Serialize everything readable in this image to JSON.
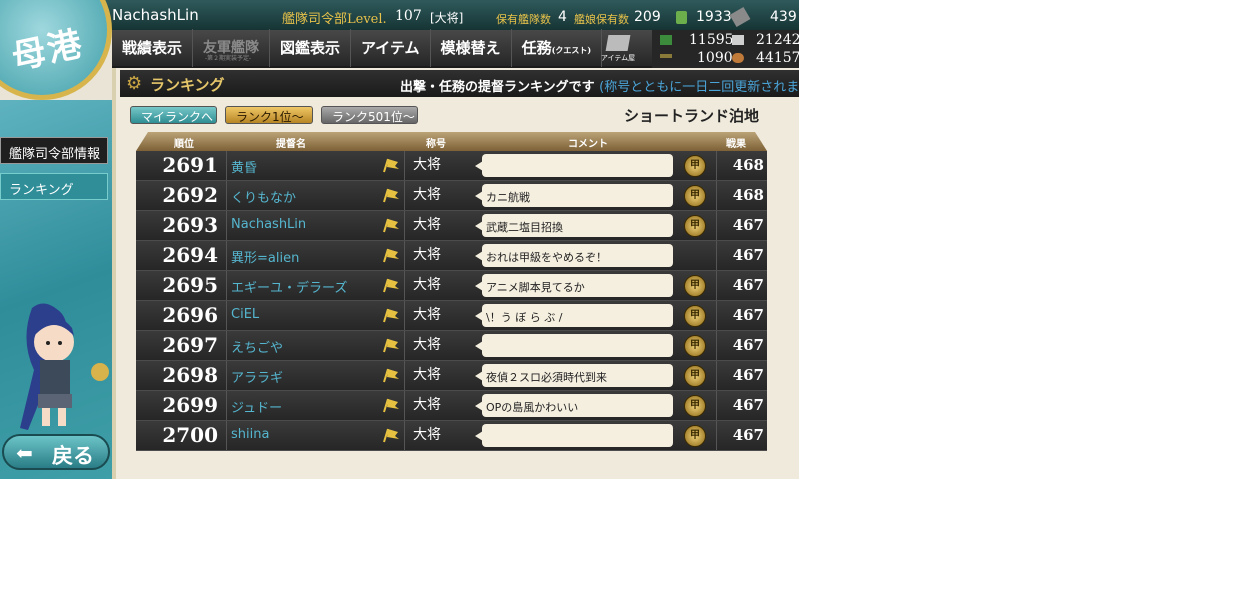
{
  "header": {
    "player_name": "NachashLin",
    "hq_level_label": "艦隊司令部Level.",
    "hq_level": "107",
    "rank_title": "[大将]",
    "ships_label": "保有艦隊数",
    "ships_value": "4",
    "equip_label": "艦娘保有数",
    "equip_value": "209",
    "buckets": "1933",
    "dev_materials": "439"
  },
  "menu": {
    "items": [
      "戦績表示",
      "友軍艦隊",
      "図鑑表示",
      "アイテム",
      "模様替え",
      "任務"
    ],
    "disabled_sub": "-第２期実装予定-",
    "quest_sub": "(クエスト)",
    "item_shop": "アイテム屋"
  },
  "resources": {
    "fuel": "11595",
    "ammo": "1090",
    "steel": "21242",
    "bauxite": "44157"
  },
  "logo": {
    "text": "母港"
  },
  "sidebar": {
    "items": [
      {
        "label": "艦隊司令部情報"
      },
      {
        "label": "ランキング"
      }
    ],
    "back_label": "戻る"
  },
  "panel": {
    "title": "ランキング",
    "description": "出撃・任務の提督ランキングです",
    "note": "(称号とともに一日二回更新されます)",
    "tabs": [
      "マイランクへ",
      "ランク1位～",
      "ランク501位～"
    ],
    "base_name": "ショートランド泊地"
  },
  "table": {
    "headers": [
      "順位",
      "提督名",
      "称号",
      "コメント",
      "戦果"
    ],
    "rows": [
      {
        "rank": "2691",
        "name": "黄昏",
        "title": "大将",
        "comment": "",
        "medal": true,
        "score": "468"
      },
      {
        "rank": "2692",
        "name": "くりもなか",
        "title": "大将",
        "comment": "カニ航戦",
        "medal": true,
        "score": "468"
      },
      {
        "rank": "2693",
        "name": "NachashLin",
        "title": "大将",
        "comment": "武蔵二塩目招換",
        "medal": true,
        "score": "467"
      },
      {
        "rank": "2694",
        "name": "異形=alien",
        "title": "大将",
        "comment": "おれは甲級をやめるぞ！",
        "medal": false,
        "score": "467"
      },
      {
        "rank": "2695",
        "name": "エギーユ・デラーズ",
        "title": "大将",
        "comment": "アニメ脚本見てるか",
        "medal": true,
        "score": "467"
      },
      {
        "rank": "2696",
        "name": "CiEL",
        "title": "大将",
        "comment": "\\！う ぼ ら ぶ /",
        "medal": true,
        "score": "467"
      },
      {
        "rank": "2697",
        "name": "えちごや",
        "title": "大将",
        "comment": "",
        "medal": true,
        "score": "467"
      },
      {
        "rank": "2698",
        "name": "アララギ",
        "title": "大将",
        "comment": "夜偵２スロ必須時代到来",
        "medal": true,
        "score": "467"
      },
      {
        "rank": "2699",
        "name": "ジュドー",
        "title": "大将",
        "comment": "OPの島風かわいい",
        "medal": true,
        "score": "467"
      },
      {
        "rank": "2700",
        "name": "shiina",
        "title": "大将",
        "comment": "",
        "medal": true,
        "score": "467"
      }
    ]
  },
  "colors": {
    "accent_gold": "#c8a443",
    "name_blue": "#55b6cf",
    "teal": "#2f8e98"
  }
}
